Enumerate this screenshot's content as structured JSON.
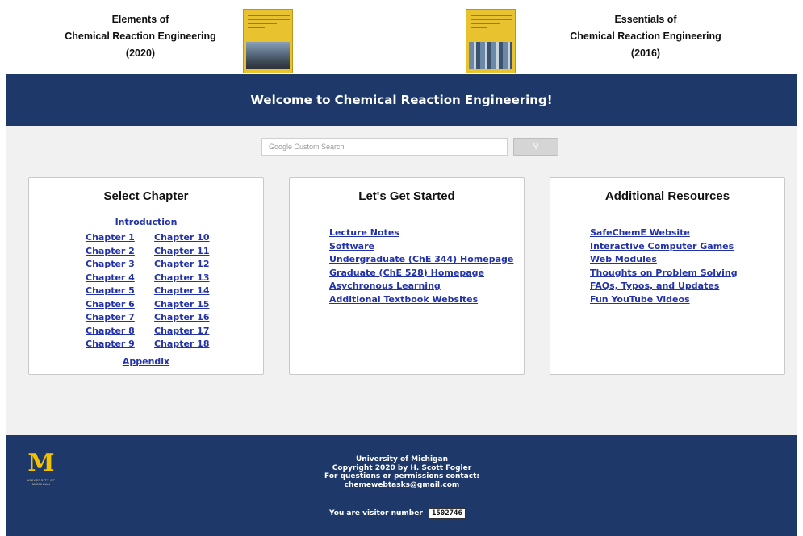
{
  "header": {
    "left_book": {
      "line1": "Elements of",
      "line2": "Chemical Reaction Engineering",
      "line3": "(2020)"
    },
    "right_book": {
      "line1": "Essentials of",
      "line2": "Chemical Reaction Engineering",
      "line3": "(2016)"
    },
    "banner_title": "Welcome to Chemical Reaction Engineering!"
  },
  "search": {
    "placeholder": "Google Custom Search",
    "button_icon": "search-icon"
  },
  "panels": {
    "chapters": {
      "title": "Select Chapter",
      "intro": "Introduction",
      "col1": [
        "Chapter 1",
        "Chapter 2",
        "Chapter 3",
        "Chapter 4",
        "Chapter 5",
        "Chapter 6",
        "Chapter 7",
        "Chapter 8",
        "Chapter 9"
      ],
      "col2": [
        "Chapter 10",
        "Chapter 11",
        "Chapter 12",
        "Chapter 13",
        "Chapter 14",
        "Chapter 15",
        "Chapter 16",
        "Chapter 17",
        "Chapter 18"
      ],
      "appendix": "Appendix"
    },
    "started": {
      "title": "Let's Get Started",
      "links": [
        "Lecture Notes",
        "Software",
        "Undergraduate (ChE 344) Homepage",
        "Graduate (ChE 528) Homepage",
        "Asychronous Learning",
        "Additional Textbook Websites"
      ]
    },
    "resources": {
      "title": "Additional Resources",
      "links": [
        "SafeChemE Website",
        "Interactive Computer Games",
        "Web Modules",
        "Thoughts on Problem Solving",
        "FAQs, Typos, and Updates",
        "Fun YouTube Videos"
      ]
    }
  },
  "footer": {
    "logo_letter": "M",
    "logo_sub": "UNIVERSITY OF MICHIGAN",
    "line1": "University of Michigan",
    "line2": "Copyright 2020 by H. Scott Fogler",
    "line3": "For questions or permissions contact:",
    "line4": "chemewebtasks@gmail.com",
    "visitor_label": "You are visitor number",
    "visitor_count": "1502746"
  },
  "colors": {
    "navy": "#1d3869",
    "link": "#2232a8",
    "maize": "#f2c200"
  }
}
